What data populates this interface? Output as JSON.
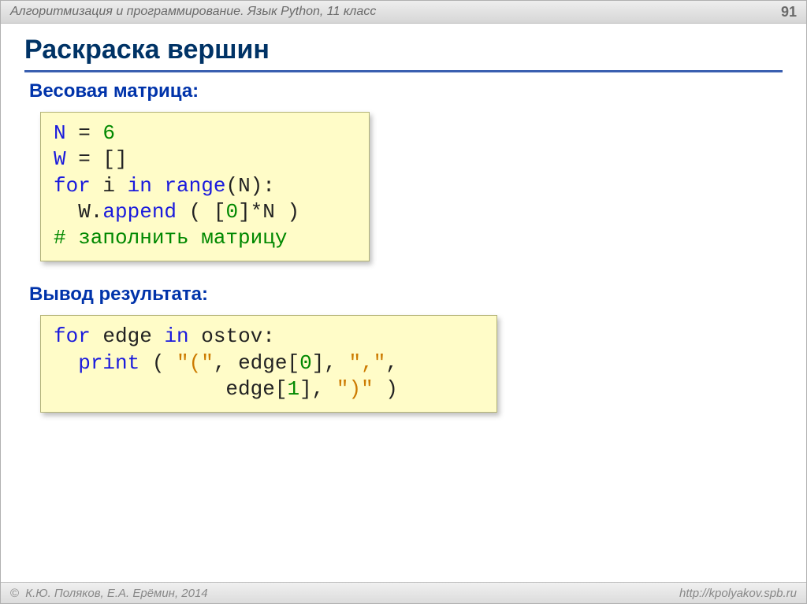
{
  "header": {
    "topic": "Алгоритмизация и программирование. Язык Python, 11 класс",
    "page_number": "91"
  },
  "title": "Раскраска вершин",
  "section1_label": "Весовая матрица:",
  "section2_label": "Вывод результата:",
  "code1": {
    "l1_a": "N",
    "l1_eq": " = ",
    "l1_v": "6",
    "l2_a": "W",
    "l2_eq": " = []",
    "l3_kw": "for",
    "l3_i": " i ",
    "l3_in": "in",
    "l3_fn": " range",
    "l3_tail": "(N):",
    "l4_ind": "  W.",
    "l4_fn": "append",
    "l4_mid": " ( [",
    "l4_zero": "0",
    "l4_end": "]*N )",
    "l5_comment": "# заполнить матрицу"
  },
  "code2": {
    "l1_kw": "for",
    "l1_v": " edge ",
    "l1_in": "in",
    "l1_tail": " ostov:",
    "l2_ind": "  ",
    "l2_fn": "print",
    "l2_a": " ( ",
    "l2_s1": "\"(\"",
    "l2_b": ", edge[",
    "l2_n0": "0",
    "l2_c": "], ",
    "l2_s2": "\",\"",
    "l2_d": ",",
    "l3_ind": "              edge[",
    "l3_n1": "1",
    "l3_a": "], ",
    "l3_s": "\")\"",
    "l3_end": " )"
  },
  "footer": {
    "copyright": "К.Ю. Поляков, Е.А. Ерёмин, 2014",
    "url": "http://kpolyakov.spb.ru"
  }
}
